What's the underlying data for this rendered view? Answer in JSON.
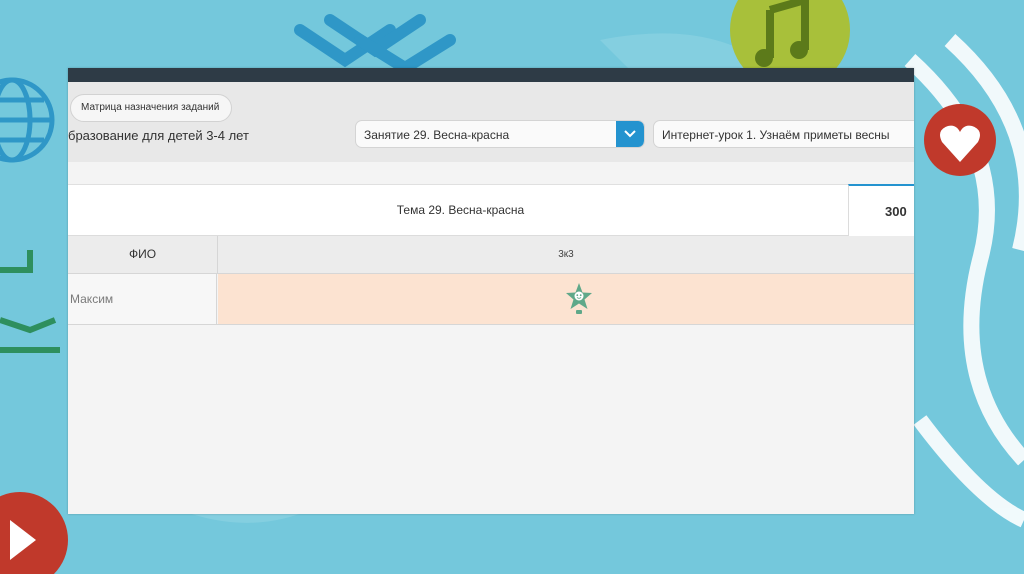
{
  "header": {
    "matrix_button": "Матрица назначения заданий",
    "course_title": "бразование для детей 3-4 лет",
    "lesson_select": "Занятие 29. Весна-красна",
    "web_lesson_select": "Интернет-урок 1. Узнаём приметы весны"
  },
  "topic": {
    "title": "Тема 29. Весна-красна",
    "score": "300"
  },
  "table": {
    "headers": [
      "ФИО",
      "3к3"
    ],
    "rows": [
      {
        "name": "Максим",
        "status_icon": "star-icon"
      }
    ]
  },
  "colors": {
    "accent": "#2493cf",
    "row_highlight": "#fce3d1",
    "star": "#5fa889",
    "topbar": "#2e3b46"
  },
  "icons": [
    "chevron-down-icon",
    "star-icon",
    "globe-icon",
    "heart-icon",
    "play-icon",
    "music-note-icon",
    "download-icon"
  ]
}
